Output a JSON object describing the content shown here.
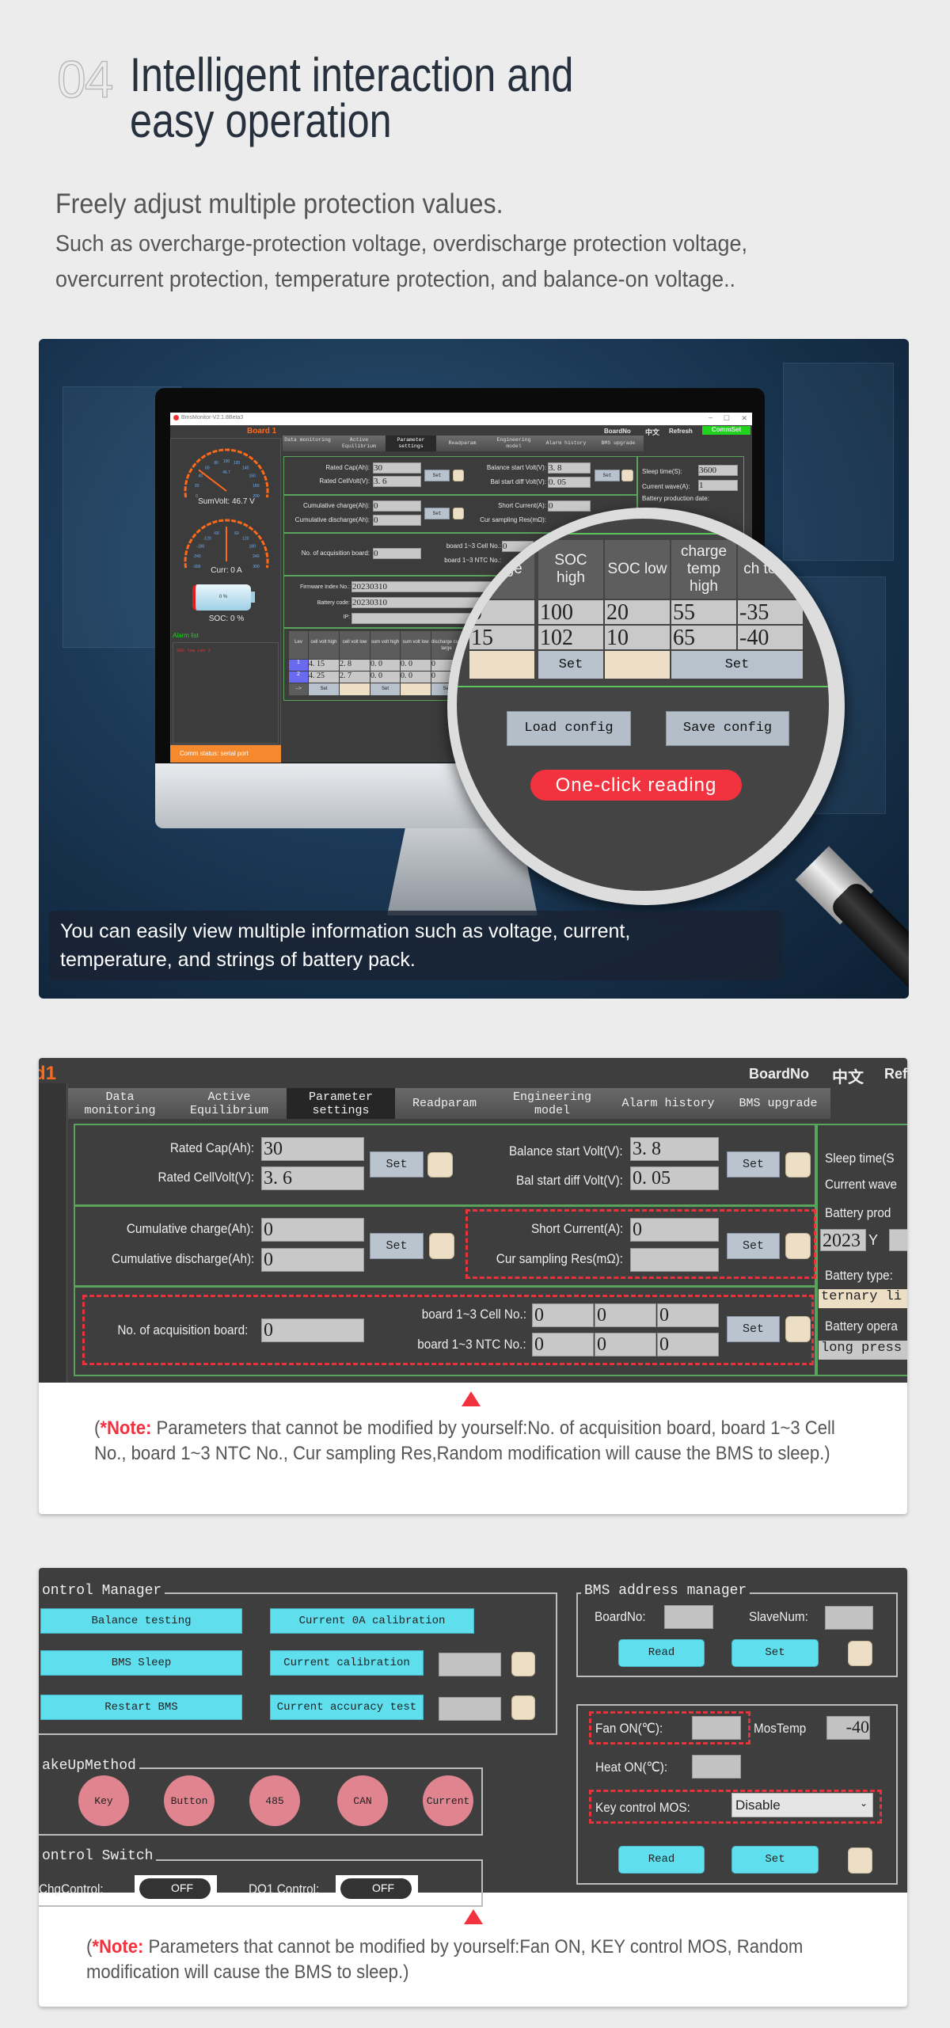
{
  "header": {
    "number": "04",
    "title_line1": "Intelligent interaction and",
    "title_line2": "easy operation",
    "subtitle": "Freely adjust multiple protection values.",
    "desc_line1": "Such as overcharge-protection voltage, overdischarge protection voltage,",
    "desc_line2": "overcurrent protection, temperature protection, and balance-on voltage.."
  },
  "photo": {
    "screen": {
      "window_title": "BmsMonitor-V2.1.8Beta3",
      "board": "Board 1",
      "top_links": [
        "BoardNo",
        "中文",
        "Refresh",
        "CommSet"
      ],
      "gauge_volt": {
        "ticks": [
          0,
          20,
          40,
          60,
          80,
          100,
          120,
          140,
          160,
          180,
          200
        ],
        "center": "46.7",
        "value": 46.7
      },
      "gauge_curr": {
        "ticks": [
          -300,
          -240,
          -180,
          -120,
          -60,
          0,
          60,
          120,
          180,
          240,
          300
        ],
        "value": 0
      },
      "sumvolt": "SumVolt: 46.7 V",
      "curr": "Curr: 0 A",
      "battery_pct": "0 %",
      "soc": "SOC: 0 %",
      "alarm_title": "Alarm list",
      "alarm_item": "SOC low Lev 2",
      "comm_status": "Comm status: serial port",
      "tabs": [
        "Data monitoring",
        "Active Equilibrium",
        "Parameter settings",
        "Readparam",
        "Engineering model",
        "Alarm history",
        "BMS upgrade"
      ],
      "rated_cap_label": "Rated Cap(Ah):",
      "rated_cap": "30",
      "rated_cellvolt_label": "Rated CellVolt(V):",
      "rated_cellvolt": "3. 6",
      "bal_start_label": "Balance start Volt(V):",
      "bal_start": "3. 8",
      "bal_diff_label": "Bal start diff Volt(V):",
      "bal_diff": "0. 05",
      "cum_charge_label": "Cumulative charge(Ah):",
      "cum_charge": "0",
      "cum_discharge_label": "Cumulative discharge(Ah):",
      "cum_discharge": "0",
      "short_label": "Short Current(A):",
      "short": "0",
      "res_label": "Cur sampling Res(mΩ):",
      "acq_label": "No. of acquisition board:",
      "acq": "0",
      "cell_no_label": "board 1~3 Cell No.:",
      "cell_no": "0",
      "ntc_label": "board 1~3 NTC No.:",
      "fw_label": "Firmware Index No.:",
      "fw": "20230310",
      "code_label": "Battery code:",
      "code": "20230310",
      "ip_label": "IP:",
      "sleep_label": "Sleep time(S):",
      "sleep": "3600",
      "wave_label": "Current wave(A):",
      "wave": "1",
      "prod_label": "Battery production date:",
      "set": "Set",
      "table": {
        "headers": [
          "Lev",
          "cell volt high",
          "cell volt low",
          "sum volt high",
          "sum volt low",
          "discharge curr large"
        ],
        "rows": [
          [
            "4. 15",
            "2. 8",
            "0. 0",
            "0. 0",
            "0"
          ],
          [
            "4. 25",
            "2. 7",
            "0. 0",
            "0. 0",
            "0"
          ]
        ],
        "arrow": "-->"
      }
    },
    "lens": {
      "headers": [
        "diff\nge",
        "SOC high",
        "SOC low",
        "charge temp high",
        "ch temp"
      ],
      "rows": [
        [
          "0",
          "100",
          "20",
          "55",
          "-35"
        ],
        [
          "15",
          "102",
          "10",
          "65",
          "-40"
        ]
      ],
      "set": "Set",
      "load": "Load config",
      "save": "Save config",
      "badge": "One-click reading",
      "badge_color": "#f2323e"
    },
    "caption_line1": "You can easily view multiple information such as voltage, current,",
    "caption_line2": "temperature, and strings of battery pack."
  },
  "panel1": {
    "board": "d1",
    "top_links": [
      "BoardNo",
      "中文",
      "Ref"
    ],
    "tabs": [
      [
        "Data",
        "monitoring"
      ],
      [
        "Active",
        "Equilibrium"
      ],
      [
        "Parameter",
        "settings"
      ],
      [
        "Readparam",
        ""
      ],
      [
        "Engineering",
        "model"
      ],
      [
        "Alarm history",
        ""
      ],
      [
        "BMS upgrade",
        ""
      ]
    ],
    "rated_cap_label": "Rated Cap(Ah):",
    "rated_cap": "30",
    "rated_cellvolt_label": "Rated CellVolt(V):",
    "rated_cellvolt": "3. 6",
    "bal_start_label": "Balance start Volt(V):",
    "bal_start": "3. 8",
    "bal_diff_label": "Bal start diff Volt(V):",
    "bal_diff": "0. 05",
    "cum_charge_label": "Cumulative charge(Ah):",
    "cum_charge": "0",
    "cum_discharge_label": "Cumulative discharge(Ah):",
    "cum_discharge": "0",
    "short_label": "Short Current(A):",
    "short": "0",
    "res_label": "Cur sampling Res(mΩ):",
    "res": "",
    "acq_label": "No. of acquisition board:",
    "acq": "0",
    "cell_no_label": "board 1~3 Cell No.:",
    "ntc_label": "board 1~3 NTC No.:",
    "cell_no": [
      "0",
      "0",
      "0"
    ],
    "ntc_no": [
      "0",
      "0",
      "0"
    ],
    "set": "Set",
    "side": {
      "sleep": "Sleep time(S",
      "wave": "Current wave",
      "prod": "Battery prod",
      "year": "2023",
      "year_unit": "Y",
      "type_label": "Battery type:",
      "type": "ternary li",
      "oper_label": "Battery opera",
      "oper": "long press"
    },
    "note_open": "(",
    "note_label": "*Note:",
    "note_text": " Parameters that cannot be modified by yourself:No. of acquisition board, board 1~3 Cell No., board 1~3 NTC No., Cur sampling Res,Random modification will cause the BMS to sleep.)"
  },
  "panel2": {
    "control_title": "ontrol Manager",
    "buttons": [
      "Balance testing",
      "Current 0A calibration",
      "BMS Sleep",
      "Current calibration",
      "Restart BMS",
      "Current accuracy test"
    ],
    "addr_title": "BMS address manager",
    "boardno_label": "BoardNo:",
    "slavenum_label": "SlaveNum:",
    "read": "Read",
    "set": "Set",
    "fan_label": "Fan ON(℃):",
    "mostemp_label": "MosTemp",
    "mostemp": "-40",
    "heat_label": "Heat ON(℃):",
    "keymos_label": "Key control MOS:",
    "keymos": "Disable",
    "wake_title": "akeUpMethod",
    "wake": [
      "Key",
      "Button",
      "485",
      "CAN",
      "Current"
    ],
    "switch_title": "ontrol Switch",
    "chg_label": "ChgControl:",
    "do1_label": "DO1 Control:",
    "off": "OFF",
    "note_open": "(",
    "note_label": "*Note:",
    "note_text": " Parameters that cannot be modified by yourself:Fan ON, KEY control MOS, Random modification will cause the BMS to sleep.)"
  }
}
